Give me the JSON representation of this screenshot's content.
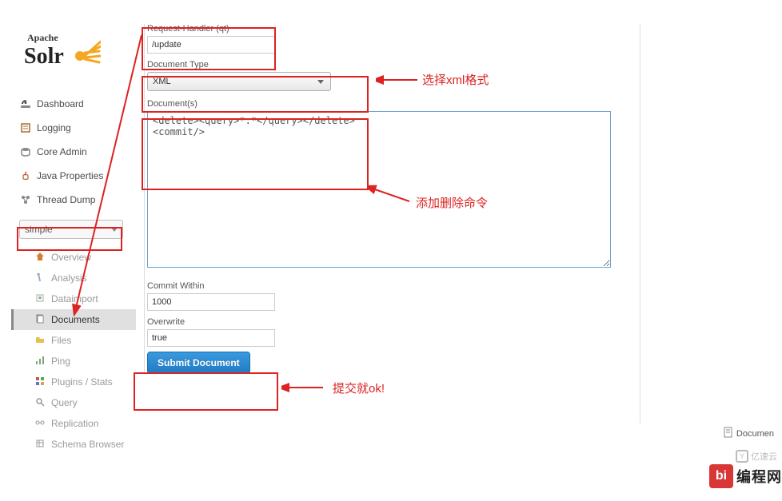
{
  "logo": {
    "top": "Apache",
    "brand": "Solr"
  },
  "nav": {
    "dashboard": "Dashboard",
    "logging": "Logging",
    "coreadmin": "Core Admin",
    "javaprops": "Java Properties",
    "threaddump": "Thread Dump"
  },
  "coreSelect": "simple",
  "subnav": {
    "overview": "Overview",
    "analysis": "Analysis",
    "dataimport": "Dataimport",
    "documents": "Documents",
    "files": "Files",
    "ping": "Ping",
    "plugins": "Plugins / Stats",
    "query": "Query",
    "replication": "Replication",
    "schema": "Schema Browser"
  },
  "form": {
    "qtLabel": "Request-Handler (qt)",
    "qtValue": "/update",
    "doctypeLabel": "Document Type",
    "doctypeValue": "XML",
    "docsLabel": "Document(s)",
    "docsValue": "<delete><query>*:*</query></delete>\n<commit/>",
    "commitLabel": "Commit Within",
    "commitValue": "1000",
    "overwriteLabel": "Overwrite",
    "overwriteValue": "true",
    "submit": "Submit Document"
  },
  "annotations": {
    "a1": "选择xml格式",
    "a2": "添加删除命令",
    "a3": "提交就ok!"
  },
  "footer": {
    "docLink": "Documen",
    "brand": "编程网",
    "brandSq": "bi",
    "yzy": "亿速云"
  }
}
